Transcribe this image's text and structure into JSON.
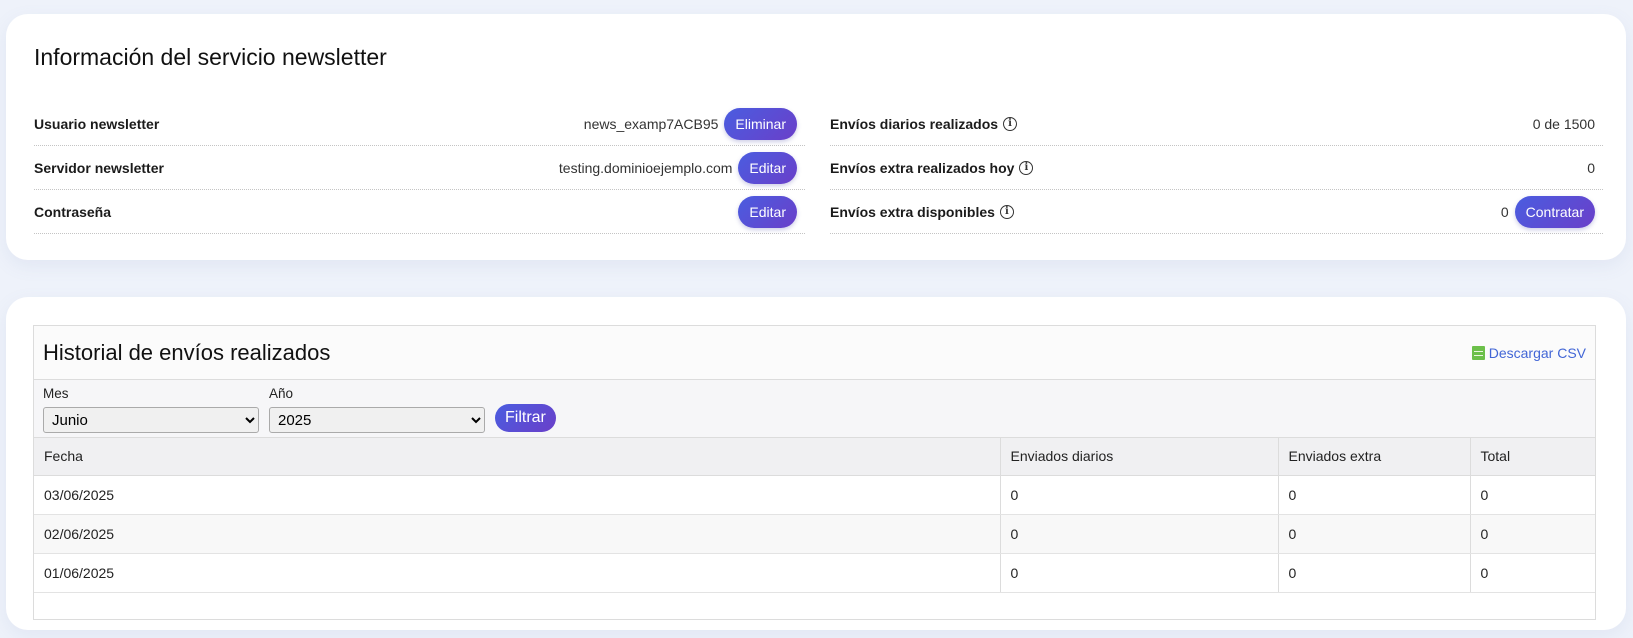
{
  "info": {
    "title": "Información del servicio newsletter",
    "left_rows": [
      {
        "label": "Usuario newsletter",
        "value": "news_examp7ACB95",
        "button": "Eliminar"
      },
      {
        "label": "Servidor newsletter",
        "value": "testing.dominioejemplo.com",
        "button": "Editar"
      },
      {
        "label": "Contraseña",
        "value": "",
        "button": "Editar"
      }
    ],
    "right_rows": [
      {
        "label": "Envíos diarios realizados",
        "value": "0 de 1500",
        "button": ""
      },
      {
        "label": "Envíos extra realizados hoy",
        "value": "0",
        "button": ""
      },
      {
        "label": "Envíos extra disponibles",
        "value": "0",
        "button": "Contratar"
      }
    ],
    "info_glyph": "i"
  },
  "history": {
    "title": "Historial de envíos realizados",
    "csv_label": "Descargar CSV",
    "month_label": "Mes",
    "month_value": "Junio",
    "year_label": "Año",
    "year_value": "2025",
    "filter_label": "Filtrar",
    "columns": [
      "Fecha",
      "Enviados diarios",
      "Enviados extra",
      "Total"
    ],
    "rows": [
      [
        "03/06/2025",
        "0",
        "0",
        "0"
      ],
      [
        "02/06/2025",
        "0",
        "0",
        "0"
      ],
      [
        "01/06/2025",
        "0",
        "0",
        "0"
      ]
    ]
  },
  "colors": {
    "accent_start": "#4a5de0",
    "accent_end": "#6a3fc9",
    "csv_icon": "#6cc04a",
    "link": "#4266d6"
  }
}
